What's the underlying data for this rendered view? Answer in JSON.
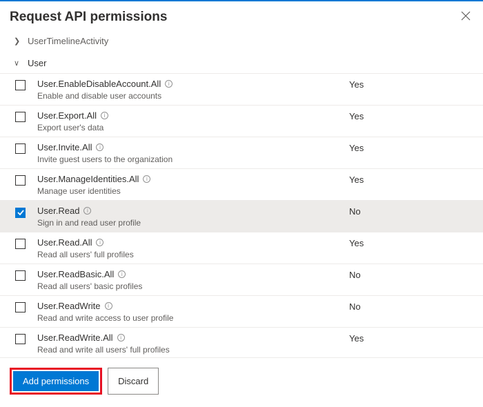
{
  "panel_title": "Request API permissions",
  "collapsed_section_label": "UserTimelineActivity",
  "expanded_section_label": "User",
  "permissions": [
    {
      "name": "User.EnableDisableAccount.All",
      "desc": "Enable and disable user accounts",
      "consent": "Yes",
      "checked": false,
      "selected": false
    },
    {
      "name": "User.Export.All",
      "desc": "Export user's data",
      "consent": "Yes",
      "checked": false,
      "selected": false
    },
    {
      "name": "User.Invite.All",
      "desc": "Invite guest users to the organization",
      "consent": "Yes",
      "checked": false,
      "selected": false
    },
    {
      "name": "User.ManageIdentities.All",
      "desc": "Manage user identities",
      "consent": "Yes",
      "checked": false,
      "selected": false
    },
    {
      "name": "User.Read",
      "desc": "Sign in and read user profile",
      "consent": "No",
      "checked": true,
      "selected": true
    },
    {
      "name": "User.Read.All",
      "desc": "Read all users' full profiles",
      "consent": "Yes",
      "checked": false,
      "selected": false
    },
    {
      "name": "User.ReadBasic.All",
      "desc": "Read all users' basic profiles",
      "consent": "No",
      "checked": false,
      "selected": false
    },
    {
      "name": "User.ReadWrite",
      "desc": "Read and write access to user profile",
      "consent": "No",
      "checked": false,
      "selected": false
    },
    {
      "name": "User.ReadWrite.All",
      "desc": "Read and write all users' full profiles",
      "consent": "Yes",
      "checked": false,
      "selected": false
    }
  ],
  "buttons": {
    "primary": "Add permissions",
    "secondary": "Discard"
  }
}
